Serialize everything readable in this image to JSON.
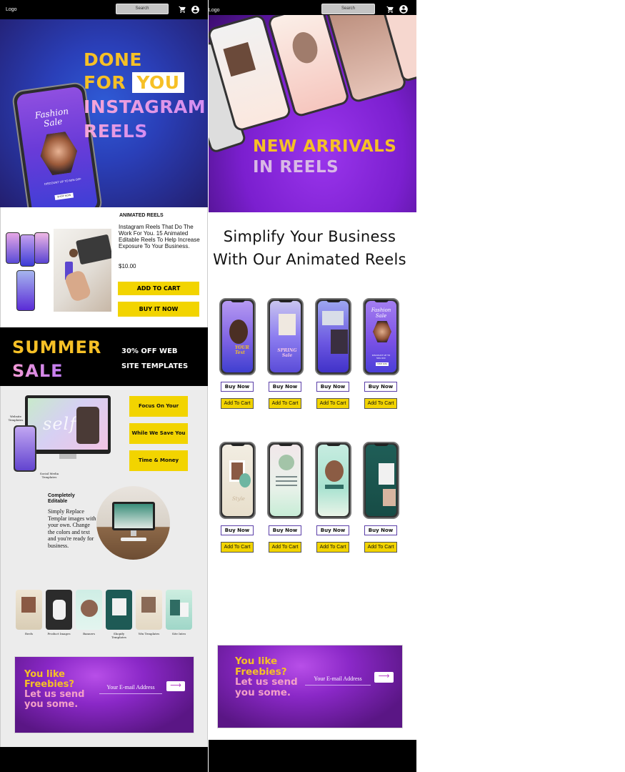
{
  "left_page": {
    "header": {
      "logo": "Logo",
      "search_placeholder": "Search"
    },
    "hero": {
      "line1": "DONE",
      "line2_prefix": "FOR",
      "line2_highlight": "YOU",
      "line3": "INSTAGRAM",
      "line4": "REELS",
      "phone_text": {
        "title_line1": "Fashion",
        "title_line2": "Sale",
        "discount": "DISCOUNT UP TO 50% OFF",
        "cta": "SHOP NOW"
      }
    },
    "product": {
      "title": "ANIMATED REELS",
      "description": "Instagram Reels That Do The Work For You. 15 Animated Editable Reels To Help Increase Exposure To Your Business.",
      "price": "$10.00",
      "add_to_cart": "ADD TO CART",
      "buy_now": "BUY IT NOW"
    },
    "sale": {
      "line1": "SUMMER",
      "line2": "SALE",
      "offer_line1": "30% OFF WEB",
      "offer_line2": "SITE TEMPLATES"
    },
    "features": {
      "buttons": [
        "Focus On Your Business",
        "While We Save You",
        "Time & Money"
      ],
      "labels": [
        "Website Templates",
        "Social Media Templates"
      ],
      "monitor_word": "selfie",
      "editable_title": "Completely Editable",
      "editable_desc": "Simply Replace Templar images with your own. Change the colors and text and you're ready for business."
    },
    "thumbnails": [
      "Reels",
      "Product Images",
      "Banners",
      "Shopify Templates",
      "Wix Templates",
      "Site Intro"
    ],
    "newsletter": {
      "line1": "You like",
      "line2": "Freebies?",
      "line3": "Let us send",
      "line4": "you some.",
      "email_placeholder": "Your E-mail Address",
      "submit_icon": "arrow-right-icon"
    }
  },
  "right_page": {
    "header": {
      "logo": "Logo",
      "search_placeholder": "Search"
    },
    "hero": {
      "line1": "NEW ARRIVALS",
      "line2": "IN REELS"
    },
    "headline_line1": "Simplify Your Business",
    "headline_line2": "With Our Animated Reels",
    "products_row1": [
      {
        "screen": "your-text-reel",
        "buy_now": "Buy Now",
        "add_to_cart": "Add To Cart"
      },
      {
        "screen": "spring-sale-reel",
        "buy_now": "Buy Now",
        "add_to_cart": "Add To Cart"
      },
      {
        "screen": "collage-reel",
        "buy_now": "Buy Now",
        "add_to_cart": "Add To Cart"
      },
      {
        "screen": "fashion-sale-reel",
        "buy_now": "Buy Now",
        "add_to_cart": "Add To Cart"
      }
    ],
    "products_row2": [
      {
        "screen": "style-reel",
        "buy_now": "Buy Now",
        "add_to_cart": "Add To Cart"
      },
      {
        "screen": "quote-reel",
        "buy_now": "Buy Now",
        "add_to_cart": "Add To Cart"
      },
      {
        "screen": "portrait-reel",
        "buy_now": "Buy Now",
        "add_to_cart": "Add To Cart"
      },
      {
        "screen": "teal-fashion-reel",
        "buy_now": "Buy Now",
        "add_to_cart": "Add To Cart"
      }
    ],
    "phone_texts": {
      "your_text": "YOUR Text",
      "spring": "SPRING Sale",
      "fashion_line1": "Fashion",
      "fashion_line2": "Sale",
      "fashion_discount": "DISCOUNT UP TO 50% OFF",
      "fashion_cta": "SHOP NOW",
      "style": "Style"
    },
    "newsletter": {
      "line1": "You like",
      "line2": "Freebies?",
      "line3": "Let us send",
      "line4": "you some.",
      "email_placeholder": "Your E-mail Address",
      "submit_icon": "arrow-right-icon"
    }
  },
  "colors": {
    "accent_yellow": "#f6c026",
    "button_yellow": "#f2d400",
    "hero_blue": "#2f5bd6",
    "purple": "#8a28c7",
    "pink": "#f0a7d7",
    "black": "#000000"
  },
  "icons": [
    "cart-icon",
    "account-icon",
    "arrow-right-icon"
  ]
}
